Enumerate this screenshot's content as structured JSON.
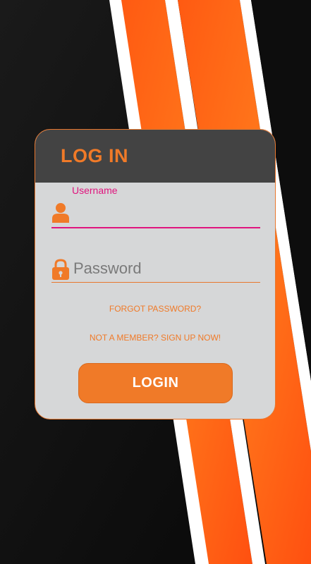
{
  "header": {
    "title": "LOG IN"
  },
  "form": {
    "username": {
      "label": "Username",
      "value": "",
      "icon": "user-icon"
    },
    "password": {
      "placeholder": "Password",
      "value": "",
      "icon": "lock-icon"
    },
    "forgot_link": "FORGOT PASSWORD?",
    "signup_link": "NOT A MEMBER? SIGN UP NOW!",
    "login_button": "LOGIN"
  },
  "colors": {
    "accent": "#f07a28",
    "focus": "#e0157e",
    "header_bg": "#434343",
    "card_bg": "#d6d7d8",
    "page_bg": "#0d0d0d"
  }
}
